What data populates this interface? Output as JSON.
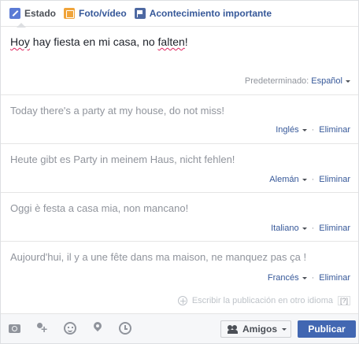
{
  "tabs": [
    {
      "label": "Estado",
      "icon": "pencil-icon"
    },
    {
      "label": "Foto/vídeo",
      "icon": "photo-icon"
    },
    {
      "label": "Acontecimiento importante",
      "icon": "flag-icon"
    }
  ],
  "post": {
    "text_word1": "Hoy",
    "text_middle": " hay fiesta en mi casa, no ",
    "text_word2": "falten",
    "text_end": "!",
    "default_label": "Predeterminado:",
    "default_language": "Español"
  },
  "translations": [
    {
      "text": "Today there's a party at my house, do not miss!",
      "language": "Inglés",
      "remove": "Eliminar"
    },
    {
      "text": "Heute gibt es Party in meinem Haus, nicht fehlen!",
      "language": "Alemán",
      "remove": "Eliminar"
    },
    {
      "text": "Oggi è festa a casa mia, non mancano!",
      "language": "Italiano",
      "remove": "Eliminar"
    },
    {
      "text": "Aujourd'hui, il y a une fête dans ma maison, ne manquez pas ça !",
      "language": "Francés",
      "remove": "Eliminar"
    }
  ],
  "add_language": {
    "label": "Escribir la publicación en otro idioma",
    "help": "[?]"
  },
  "footer": {
    "icons": [
      "camera-icon",
      "tag-people-icon",
      "smile-icon",
      "location-pin-icon",
      "clock-icon"
    ],
    "audience_label": "Amigos",
    "publish_label": "Publicar"
  },
  "colors": {
    "link": "#365899",
    "publish": "#4267b2",
    "muted": "#90949c"
  }
}
